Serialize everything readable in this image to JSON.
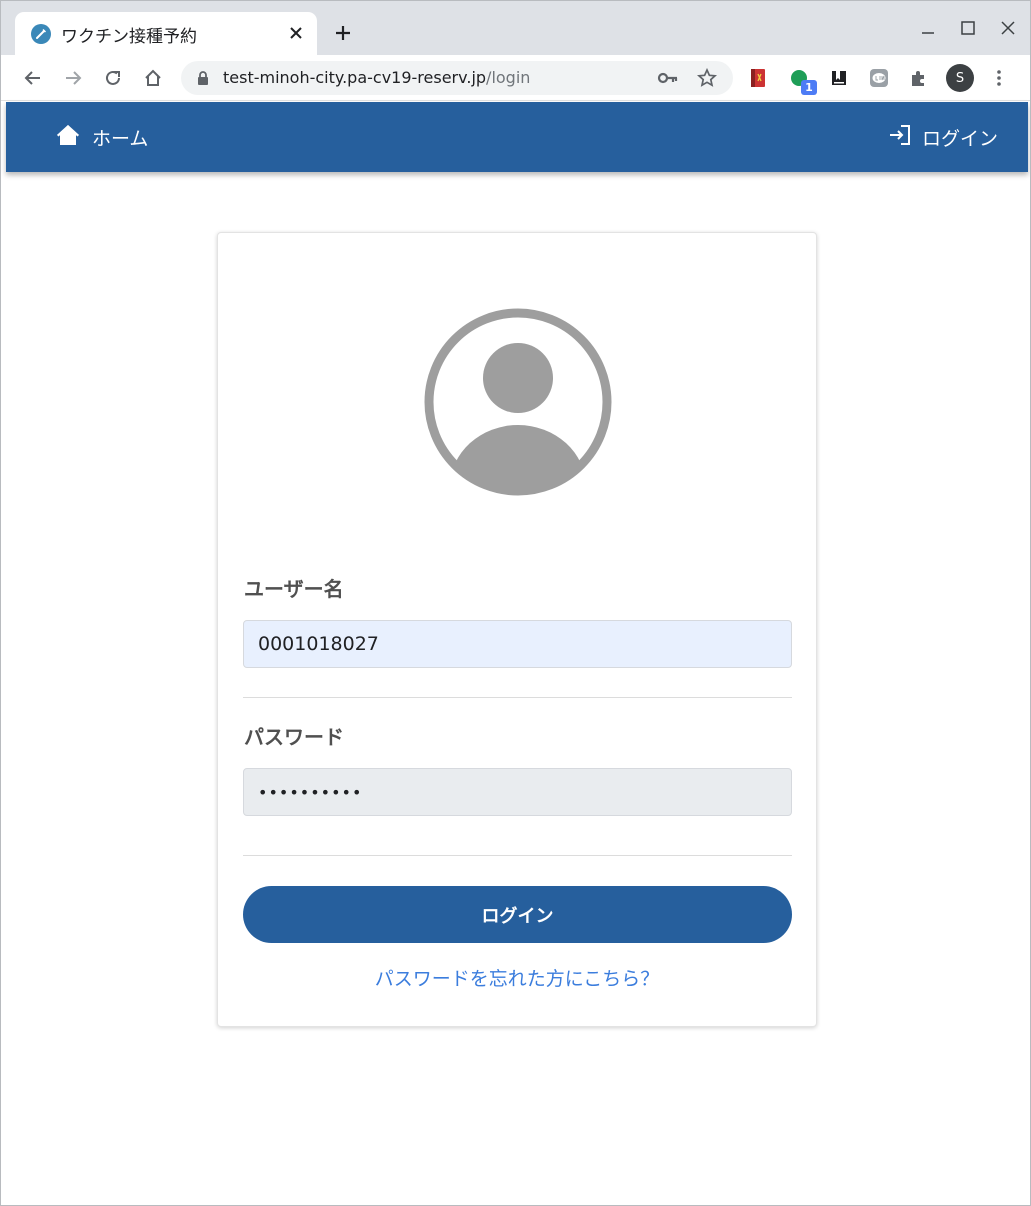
{
  "browser": {
    "tab_title": "ワクチン接種予約",
    "url_host": "test-minoh-city.pa-cv19-reserv.jp",
    "url_path": "/login",
    "extension_badge": "1",
    "profile_initial": "S"
  },
  "header": {
    "home_label": "ホーム",
    "login_label": "ログイン"
  },
  "login_form": {
    "username_label": "ユーザー名",
    "username_value": "0001018027",
    "password_label": "パスワード",
    "password_masked": "••••••••••",
    "submit_label": "ログイン",
    "forgot_link": "パスワードを忘れた方にこちら？"
  },
  "colors": {
    "brand": "#265f9d",
    "link": "#3b7ddd",
    "avatar": "#9e9e9e"
  }
}
